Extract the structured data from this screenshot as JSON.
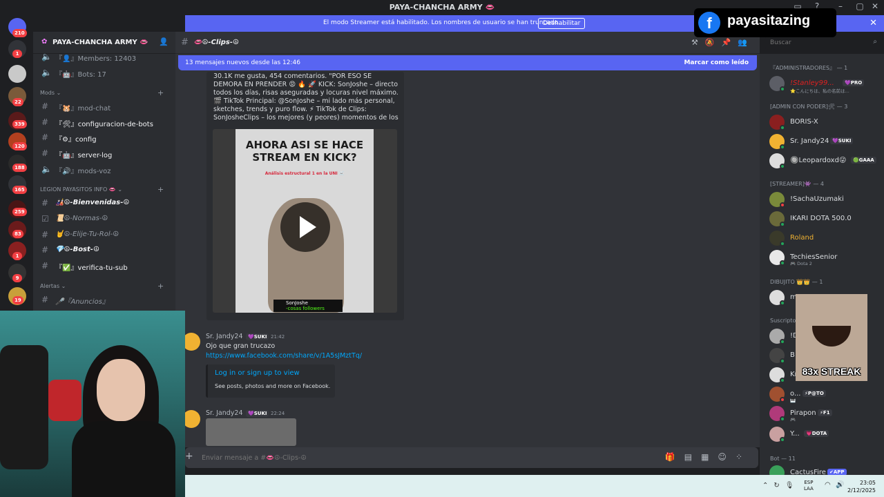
{
  "window": {
    "title": "PAYA-CHANCHA ARMY 👄"
  },
  "banner": {
    "text": "El modo Streamer está habilitado. Los nombres de usuario se han truncado.",
    "button": "Deshabilitar"
  },
  "servers": {
    "badges": [
      "210",
      "1",
      "22",
      "339",
      "120",
      "188",
      "165",
      "259",
      "83",
      "1",
      "9",
      "19"
    ]
  },
  "guild": {
    "name": "PAYA-CHANCHA ARMY 👄",
    "channels_top": [
      {
        "label": "『👤』Members: 12403"
      },
      {
        "label": "『🤖』Bots: 17"
      }
    ],
    "categories": {
      "mods": "Mods ⌄",
      "legion": "LEGION PAYASITOS INFO 👄 ⌄",
      "alertas": "Alertas ⌄"
    },
    "mods_channels": [
      {
        "label": "『🐹』mod-chat"
      },
      {
        "label": "『🛠』configuracion-de-bots"
      },
      {
        "label": "『⚙』config"
      },
      {
        "label": "『🤖』server-log"
      },
      {
        "label": "『🔊』mods-voz"
      }
    ],
    "legion_channels": [
      {
        "label": "🎎☮-Bienvenidas-☮"
      },
      {
        "label": "📜☮-Normas-☮"
      },
      {
        "label": "🤘☮-Elije-Tu-Rol-☮"
      },
      {
        "label": "💎☮-Bost-☮"
      },
      {
        "label": "『✅』verifica-tu-sub"
      }
    ],
    "alertas_channels": [
      {
        "label": "🎤『Anuncios』"
      }
    ]
  },
  "chat": {
    "channel_name": "👄☮-Clips-☮",
    "new_messages": "13 mensajes nuevos desde las 12:46",
    "mark_read": "Marcar como leído",
    "embed_text": "30.1K me gusta, 454 comentarios. \"POR ESO SE DEMORA EN PRENDER 😡 🔥 🚀 KICK: SonJoshe – directo todos los días, risas aseguradas y locuras nivel máximo. 🎬 TikTok Principal: @SonJoshe – mi lado más personal, sketches, trends y puro flow. ⚡ TikTok de Clips: SonJosheClips – los mejores (y peores) momentos de los streams JAJSJS. ...",
    "video": {
      "title": "AHORA ASI SE HACE STREAM EN KICK?",
      "subtitle": "Análisis estructural 1 en la UNI ☠️",
      "channel": "SonJoshe",
      "followers": "-cosas followers"
    },
    "messages": [
      {
        "user": "Sr. Jandy24",
        "tag": "💜SUKI",
        "time": "21:42",
        "text": "Ojo que gran trucazo",
        "link": "https://www.facebook.com/share/v/1A5sJMztTq/"
      },
      {
        "user": "Sr. Jandy24",
        "tag": "💜SUKI",
        "time": "22:24"
      }
    ],
    "link_embed": {
      "title": "Log in or sign up to view",
      "desc": "See posts, photos and more on Facebook."
    },
    "composer_placeholder": "Enviar mensaje a #👄☮-Clips-☮"
  },
  "search": {
    "placeholder": "Buscar"
  },
  "members": {
    "groups": [
      {
        "label": "『ADMINISTRADORES』 — 1"
      },
      {
        "label": "[ADMIN CON PODER]🛠 — 3"
      },
      {
        "label": "[STREAMER]👾 — 4"
      },
      {
        "label": "DIBUJITO 👑👑 — 1"
      },
      {
        "label": "Suscripto"
      },
      {
        "label": "Bot — 11"
      }
    ],
    "list": [
      {
        "name": "!Stanley99...",
        "sub": "⭐こんにちは、私の名前は...",
        "badge": "💜PRO"
      },
      {
        "name": "BORIS-X"
      },
      {
        "name": "Sr. Jandy24",
        "badge": "💜SUKI"
      },
      {
        "name": "🔘Leopardoxd😜",
        "badge": "🟢GAAA"
      },
      {
        "name": "!SachaUzumaki"
      },
      {
        "name": "IKARI DOTA 500.0"
      },
      {
        "name": "Roland"
      },
      {
        "name": "TechiesSenior",
        "sub": "🎮 Dota 2"
      },
      {
        "name": "m"
      },
      {
        "name": "!D"
      },
      {
        "name": "B"
      },
      {
        "name": "Kr"
      },
      {
        "name": "o...",
        "badge": "⚡P@TO",
        "sub": "🎹"
      },
      {
        "name": "Pirapon",
        "badge": "⚡F1",
        "sub": "🎮"
      },
      {
        "name": "Y...",
        "badge": "💗DOTA"
      },
      {
        "name": "CactusFire",
        "badge": "✔APP"
      }
    ]
  },
  "taskbar": {
    "lang_top": "ESP",
    "lang_bottom": "LAA",
    "time": "23:05",
    "date": "2/12/2025"
  },
  "overlays": {
    "facebook_name": "payasitazing",
    "streak": "83x STREAK"
  }
}
